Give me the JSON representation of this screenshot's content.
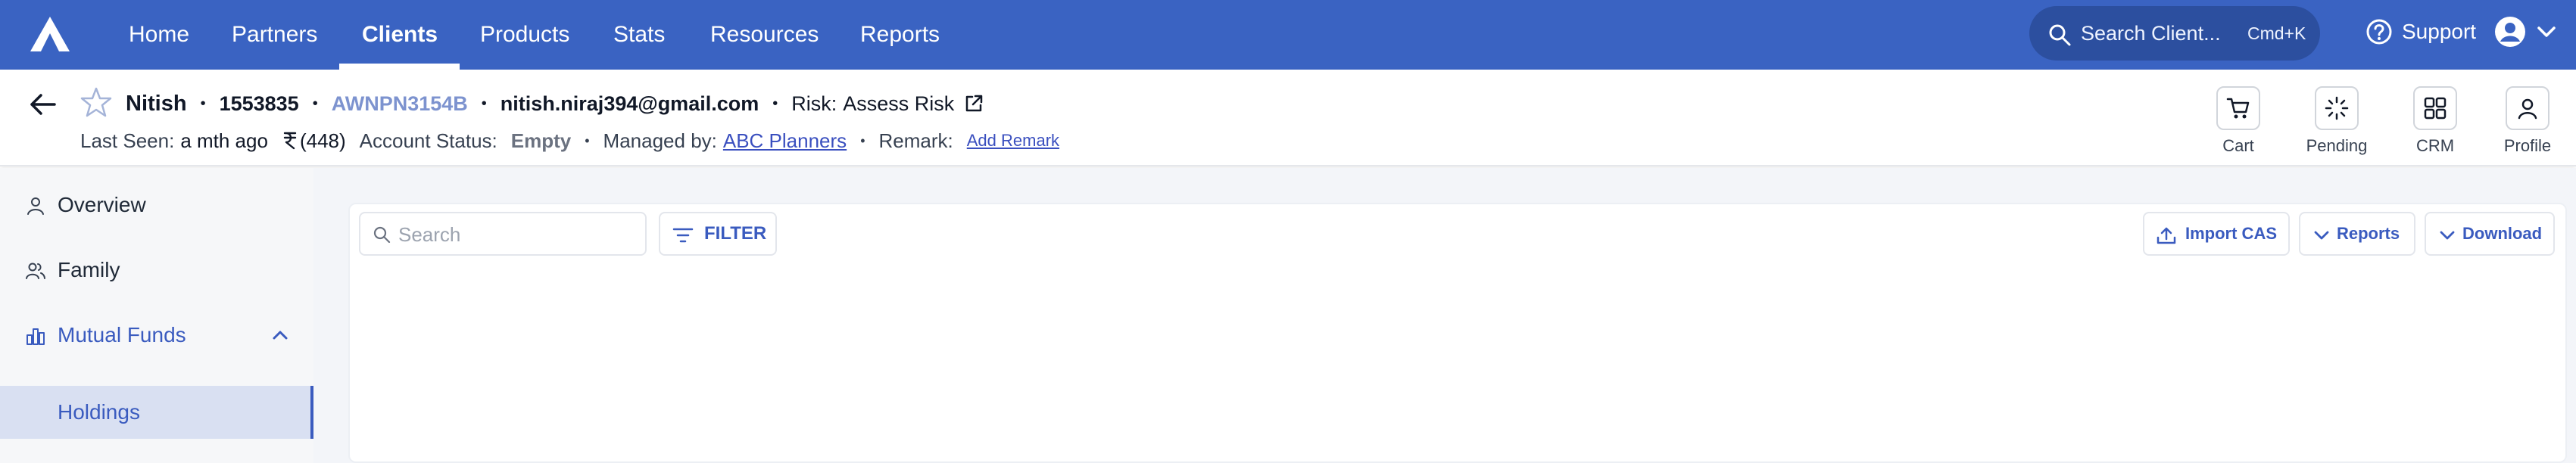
{
  "topnav": {
    "logo": "brand-logo",
    "items": [
      {
        "label": "Home",
        "active": false
      },
      {
        "label": "Partners",
        "active": false
      },
      {
        "label": "Clients",
        "active": true
      },
      {
        "label": "Products",
        "active": false
      },
      {
        "label": "Stats",
        "active": false
      },
      {
        "label": "Resources",
        "active": false
      },
      {
        "label": "Reports",
        "active": false
      }
    ],
    "search_label": "Search Client...",
    "search_shortcut": "Cmd+K",
    "support_label": "Support",
    "accent_color": "#3a63c2"
  },
  "client": {
    "name": "Nitish",
    "id": "1553835",
    "pan": "AWNPN3154B",
    "email": "nitish.niraj394@gmail.com",
    "risk_label": "Risk:",
    "risk_value": "Assess Risk",
    "last_seen_label": "Last Seen:",
    "last_seen_value": "a mth ago",
    "last_seen_days": "(448)",
    "account_status_label": "Account Status:",
    "account_status_value": "Empty",
    "managed_by_label": "Managed by:",
    "managed_by_value": "ABC Planners",
    "remark_label": "Remark:",
    "remark_action": "Add Remark"
  },
  "actions": [
    {
      "label": "Cart",
      "icon": "cart-icon"
    },
    {
      "label": "Pending",
      "icon": "spinner-icon"
    },
    {
      "label": "CRM",
      "icon": "grid-icon"
    },
    {
      "label": "Profile",
      "icon": "user-icon"
    }
  ],
  "sidebar": {
    "items": [
      {
        "label": "Overview",
        "icon": "user-icon"
      },
      {
        "label": "Family",
        "icon": "family-icon"
      },
      {
        "label": "Mutual Funds",
        "icon": "chart-icon"
      },
      {
        "label": "Holdings",
        "icon": ""
      }
    ]
  },
  "toolbar": {
    "search_placeholder": "Search",
    "filter_label": "FILTER",
    "import_label": "Import CAS",
    "reports_label": "Reports",
    "download_label": "Download"
  }
}
